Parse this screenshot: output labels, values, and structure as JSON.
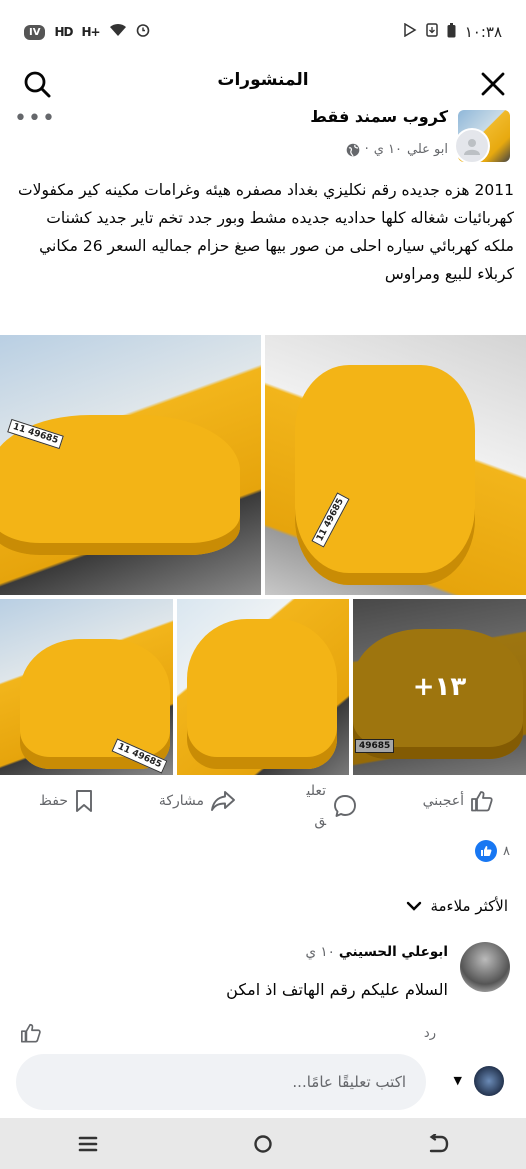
{
  "status_bar": {
    "time": "١٠:٣٨",
    "left_chip": "IV",
    "signal_1": "HD",
    "signal_2": "H+"
  },
  "header": {
    "title": "المنشورات",
    "close_icon": "close-icon",
    "search_icon": "search-icon"
  },
  "post": {
    "group_name": "كروب سمند فقط",
    "author": "ابو علي",
    "time": "١٠ ي",
    "audience_icon": "globe-icon",
    "more_label": "•••",
    "text": "2011 هزه جديده رقم نكليزي بغداد مصفره هيئه وغرامات مكينه كير مكفولات كهربائيات شغاله كلها حداديه جديده مشط وبور جدد تخم تاير جديد كشنات ملكه كهربائي سياره احلى من صور بيها صبغ حزام جماليه السعر 26 مكاني كربلاء للبيع ومراوس",
    "photos": {
      "plate_1": "11 49685",
      "plate_2": "11 49685",
      "plate_3": "11 49685",
      "plate_4": "49685",
      "more_count": "+١٣"
    }
  },
  "actions": {
    "like": "أعجبني",
    "comment": "تعليق",
    "share": "مشاركة",
    "save": "حفظ"
  },
  "reactions": {
    "count": "٨"
  },
  "comments": {
    "sort_label": "الأكثر ملاءمة",
    "items": [
      {
        "name": "ابوعلي الحسيني",
        "time": "١٠ ي",
        "text": "السلام عليكم رقم الهاتف اذ امكن"
      }
    ],
    "reply_label": "رد"
  },
  "composer": {
    "placeholder": "اكتب تعليقًا عامًا..."
  },
  "colors": {
    "accent": "#1877f2",
    "text_secondary": "#65676b",
    "nav_bg": "#e8e8e8"
  }
}
